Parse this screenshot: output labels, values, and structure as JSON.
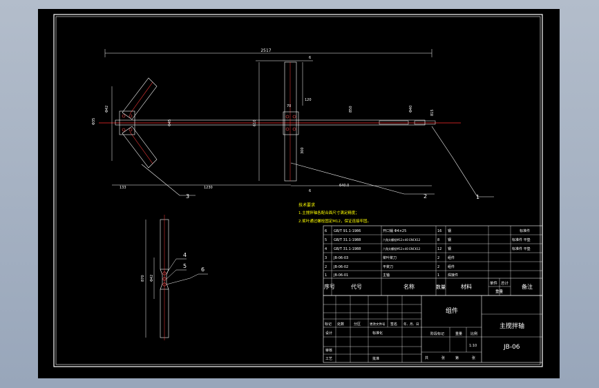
{
  "drawing": {
    "dims": {
      "overall": "2517",
      "d6a": "6",
      "d6b": "6",
      "d120": "120",
      "d70": "70",
      "d133": "133",
      "d1230": "1230",
      "d640": "640.0",
      "v850": "850",
      "v300": "300",
      "v610": "610",
      "v815": "815",
      "vsm1": "Φ42",
      "vsm2": "Φ35",
      "vsm3": "Φ45",
      "vsm4": "Φ40",
      "dside1": "870",
      "dside2": "Φ42"
    },
    "leaders": [
      "1",
      "2",
      "3",
      "4",
      "5",
      "6"
    ],
    "notes": {
      "title": "技术要求",
      "line1": "1.主搅拌轴各配合面尺寸满足精度；",
      "line2": "2.桨叶通过螺栓固定M12，保证连接牢固。"
    }
  },
  "bom": {
    "rows": [
      {
        "seq": "6",
        "code": "GB/T 91.1-1986",
        "name": "开口销 Φ4×25",
        "qty": "16",
        "mat": "钢",
        "note": "标准件"
      },
      {
        "seq": "5",
        "code": "GB/T 31.1-1988",
        "name": "六角头螺栓M12×40 ENCK12",
        "qty": "8",
        "mat": "钢",
        "note": "标准件 平垫"
      },
      {
        "seq": "4",
        "code": "GB/T 31.1-1988",
        "name": "六角头螺栓M12×40 ENCK12",
        "qty": "12",
        "mat": "钢",
        "note": "标准件 平垫"
      },
      {
        "seq": "3",
        "code": "JB-06-03",
        "name": "桨叶桨刀",
        "qty": "2",
        "mat": "组件",
        "note": ""
      },
      {
        "seq": "2",
        "code": "JB-06-02",
        "name": "平桨刀",
        "qty": "2",
        "mat": "组件",
        "note": ""
      },
      {
        "seq": "1",
        "code": "JB-06-01",
        "name": "主轴",
        "qty": "1",
        "mat": "焊接件",
        "note": ""
      }
    ],
    "header": {
      "seq": "序号",
      "code": "代号",
      "name": "名称",
      "qty": "数量",
      "mat": "材料",
      "single": "单件",
      "total": "总计",
      "weight": "重量",
      "note": "备注"
    }
  },
  "titleblock": {
    "assembly": "组件",
    "title": "主搅拌轴",
    "drawing_no": "JB-06",
    "row_labels": [
      "标记",
      "处数",
      "分区",
      "更改文件号",
      "签名",
      "年、月、日"
    ],
    "design": "设计",
    "standardize": "标准化",
    "stage": "阶段标记",
    "weight": "重量",
    "scale": "比例",
    "scale_val": "1:10",
    "review": "审核",
    "process": "工艺",
    "approve": "批准",
    "sheets": "共",
    "sheet_of": "张",
    "sheet_no": "第",
    "sheet_end": "张"
  }
}
